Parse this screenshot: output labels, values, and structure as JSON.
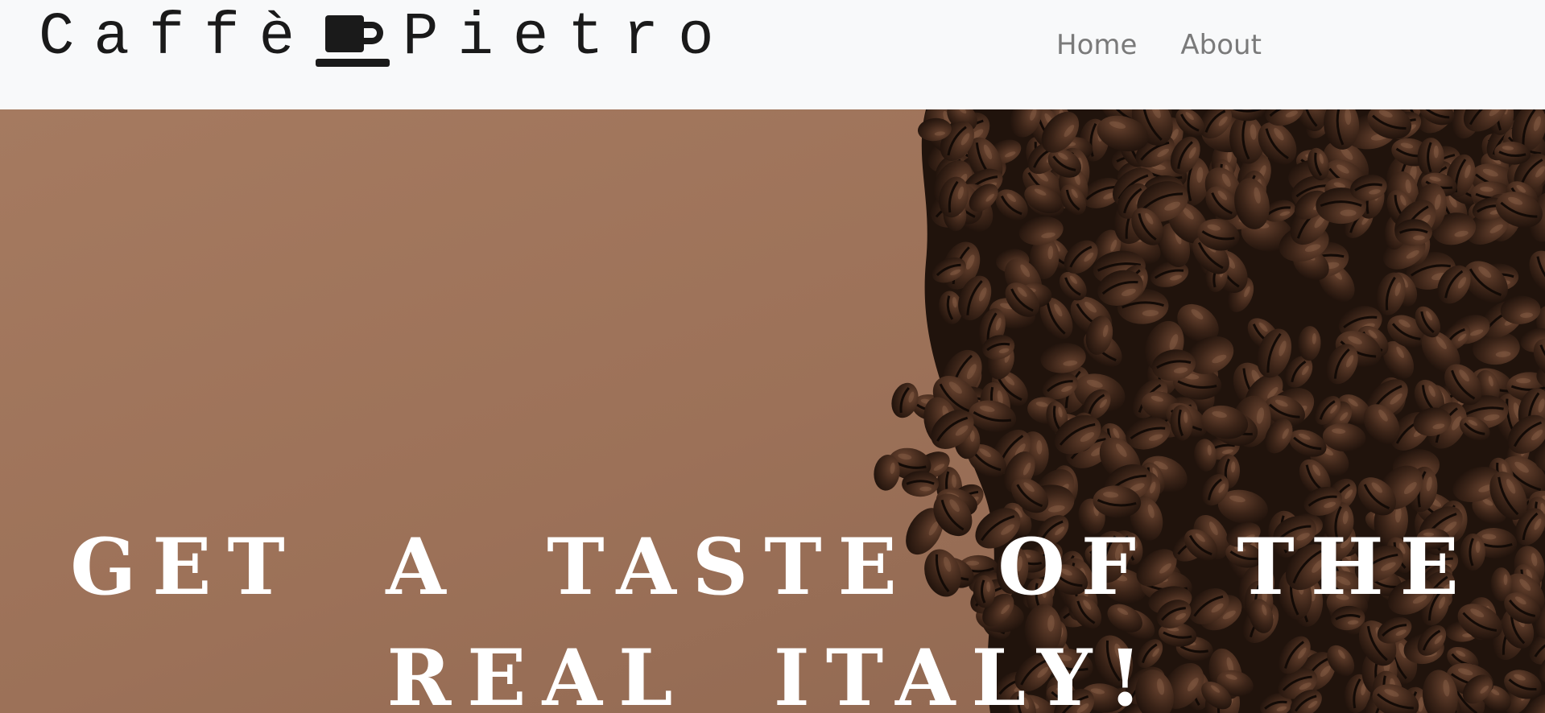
{
  "navbar": {
    "brand": {
      "text_before": "Caffè",
      "text_after": "Pietro",
      "logo_icon": "coffee-cup-icon"
    },
    "links": [
      {
        "label": "Home"
      },
      {
        "label": "About"
      }
    ]
  },
  "hero": {
    "background": "coffee-beans-photo",
    "headline": "GET A TASTE OF THE REAL ITALY!"
  },
  "colors": {
    "navbar_bg": "#f8f9fa",
    "nav_link": "#7a7a7a",
    "brand_text": "#1a1a1a",
    "hero_bg": "#9a7056",
    "headline": "#ffffff"
  }
}
